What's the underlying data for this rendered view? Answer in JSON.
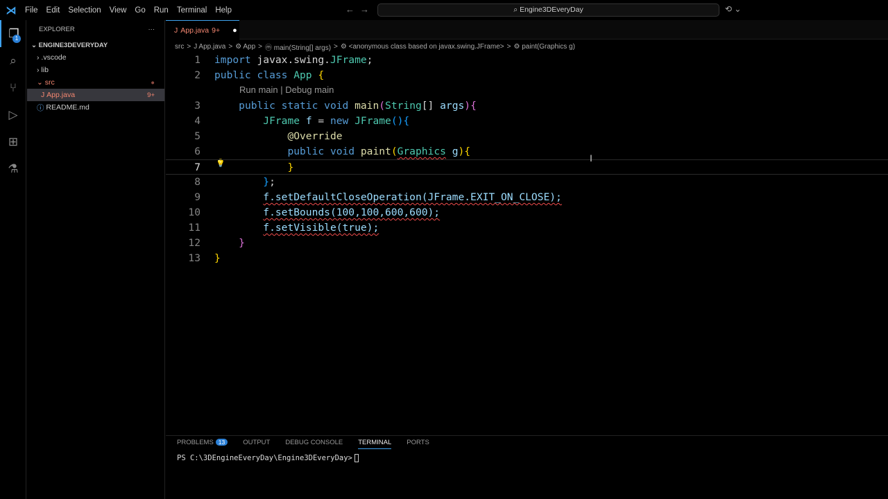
{
  "menu": [
    "File",
    "Edit",
    "Selection",
    "View",
    "Go",
    "Run",
    "Terminal",
    "Help"
  ],
  "search": "Engine3DEveryDay",
  "activity_badge": "1",
  "explorer": {
    "title": "EXPLORER",
    "more": "···",
    "root": "ENGINE3DEVERYDAY",
    "items": [
      {
        "label": ".vscode",
        "icon": "›"
      },
      {
        "label": "lib",
        "icon": "›"
      },
      {
        "label": "src",
        "icon": "⌄"
      },
      {
        "label": "App.java",
        "icon": "J",
        "right": "9+"
      },
      {
        "label": "README.md",
        "icon": "ⓘ"
      }
    ]
  },
  "tab": {
    "icon": "J",
    "label": "App.java",
    "count": "9+",
    "dirty": "●"
  },
  "breadcrumbs": [
    "src",
    ">",
    "J App.java",
    ">",
    "⚙ App",
    ">",
    "ⓜ main(String[] args)",
    ">",
    "⚙ <anonymous class based on javax.swing.JFrame>",
    ">",
    "⚙ paint(Graphics g)"
  ],
  "codelens": "Run main | Debug main",
  "current_line": 7,
  "code": [
    [
      [
        "kw",
        "import "
      ],
      [
        "pl",
        "javax.swing."
      ],
      [
        "ty",
        "JFrame"
      ],
      [
        "pl",
        ";"
      ]
    ],
    [
      [
        "kw",
        "public class "
      ],
      [
        "ty",
        "App "
      ],
      [
        "b1",
        "{"
      ]
    ],
    [
      [
        "pl",
        "    "
      ],
      [
        "kw",
        "public static void "
      ],
      [
        "fn",
        "main"
      ],
      [
        "b2",
        "("
      ],
      [
        "ty",
        "String"
      ],
      [
        "pl",
        "[] "
      ],
      [
        "va",
        "args"
      ],
      [
        "b2",
        ")"
      ],
      [
        "b2",
        "{"
      ]
    ],
    [
      [
        "pl",
        "        "
      ],
      [
        "ty",
        "JFrame "
      ],
      [
        "va",
        "f"
      ],
      [
        "pl",
        " = "
      ],
      [
        "kw",
        "new "
      ],
      [
        "ty",
        "JFrame"
      ],
      [
        "b3",
        "()"
      ],
      [
        "b3",
        "{"
      ]
    ],
    [
      [
        "pl",
        "            "
      ],
      [
        "an",
        "@Override"
      ]
    ],
    [
      [
        "pl",
        "            "
      ],
      [
        "kw",
        "public void "
      ],
      [
        "fn",
        "paint"
      ],
      [
        "b1",
        "("
      ],
      [
        "tysq",
        "Graphics"
      ],
      [
        "pl",
        " "
      ],
      [
        "va",
        "g"
      ],
      [
        "b1",
        ")"
      ],
      [
        "b1",
        "{"
      ]
    ],
    [
      [
        "pl",
        "            "
      ],
      [
        "b1",
        "}"
      ]
    ],
    [
      [
        "pl",
        "        "
      ],
      [
        "b3",
        "}"
      ],
      [
        "pl",
        ";"
      ]
    ],
    [
      [
        "pl",
        "        "
      ],
      [
        "sq",
        "f.setDefaultCloseOperation(JFrame.EXIT_ON_CLOSE);"
      ]
    ],
    [
      [
        "pl",
        "        "
      ],
      [
        "sq",
        "f.setBounds(100,100,600,600);"
      ]
    ],
    [
      [
        "pl",
        "        "
      ],
      [
        "sq",
        "f.setVisible(true);"
      ]
    ],
    [
      [
        "pl",
        "    "
      ],
      [
        "b2",
        "}"
      ]
    ],
    [
      [
        "b1",
        "}"
      ]
    ]
  ],
  "panel": {
    "tabs": [
      "PROBLEMS",
      "OUTPUT",
      "DEBUG CONSOLE",
      "TERMINAL",
      "PORTS"
    ],
    "problems_count": "13",
    "prompt": "PS C:\\3DEngineEveryDay\\Engine3DEveryDay>"
  },
  "colors": {
    "kw": "#569cd6",
    "ty": "#4ec9b0",
    "fn": "#dcdcaa",
    "va": "#9cdcfe",
    "pl": "#d4d4d4",
    "an": "#dcdcaa",
    "b1": "#ffd700",
    "b2": "#da70d6",
    "b3": "#179fff",
    "sq": "#9cdcfe",
    "accent": "#3fa3f0"
  }
}
